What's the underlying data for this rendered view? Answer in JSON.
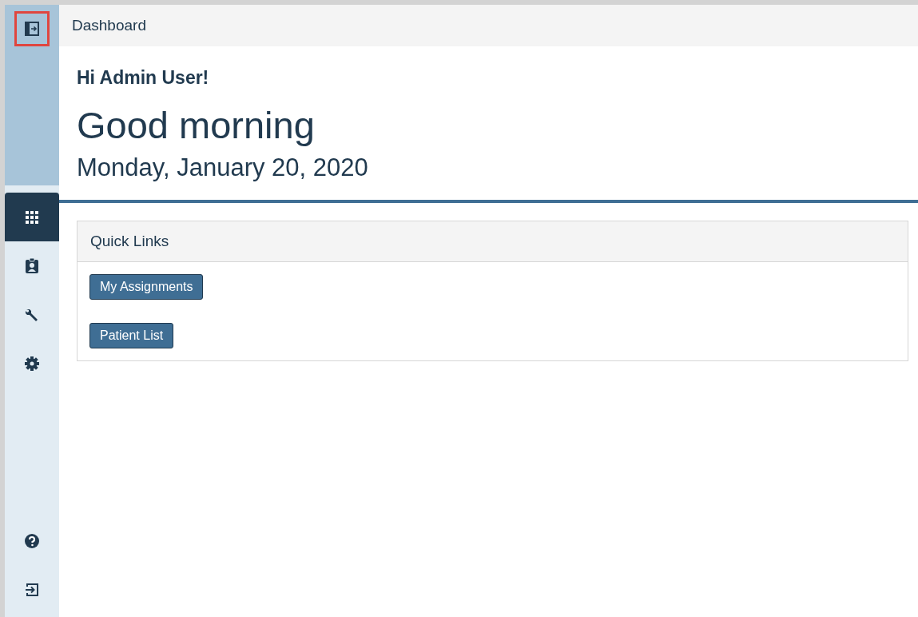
{
  "header": {
    "title": "Dashboard"
  },
  "sidebar": {
    "toggle_highlighted": true,
    "items": [
      {
        "selected": true
      },
      {
        "selected": false
      },
      {
        "selected": false
      },
      {
        "selected": false
      }
    ],
    "bottom_items": [
      {
        "selected": false
      },
      {
        "selected": false
      }
    ]
  },
  "greeting": {
    "hello": "Hi Admin User!",
    "salutation": "Good morning",
    "date": "Monday, January 20, 2020"
  },
  "quick_links": {
    "title": "Quick Links",
    "buttons": [
      "My Assignments",
      "Patient List"
    ]
  }
}
